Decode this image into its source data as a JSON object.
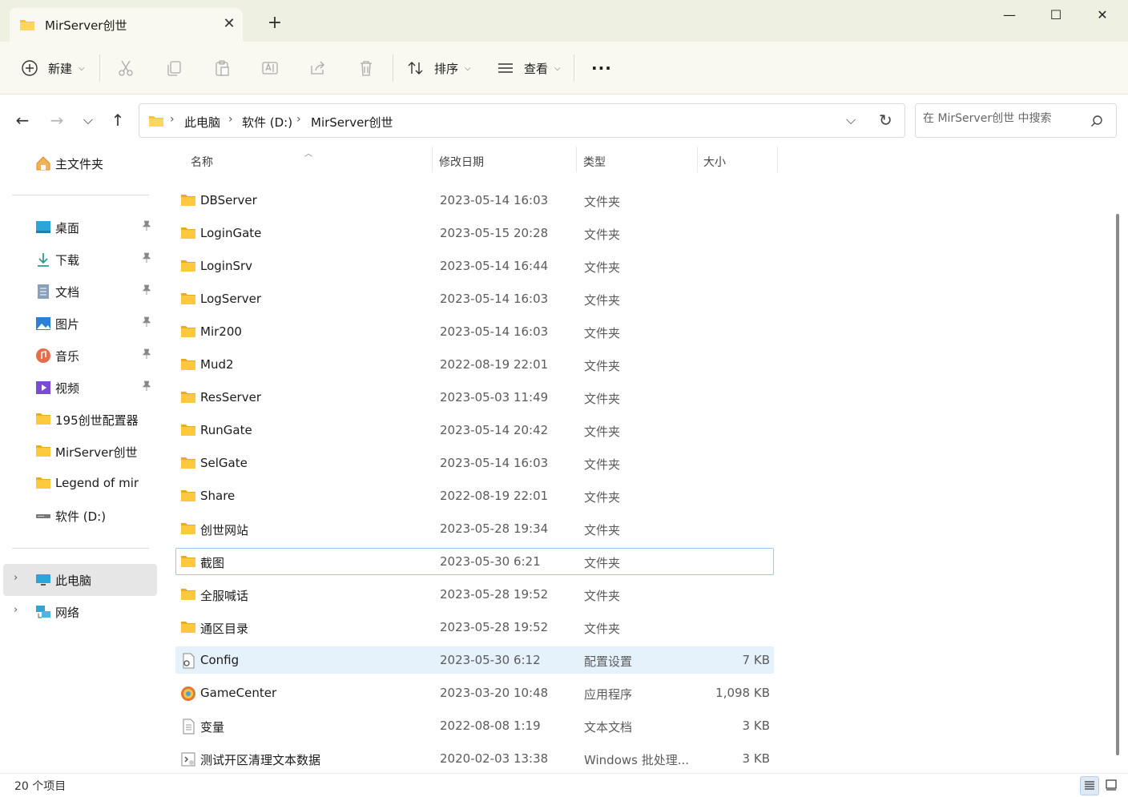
{
  "window": {
    "tab_title": "MirServer创世",
    "new_tab_icon": "plus-icon",
    "controls": {
      "minimize": "minimize-icon",
      "maximize": "maximize-icon",
      "close": "close-icon"
    }
  },
  "toolbar": {
    "new_label": "新建",
    "sort_label": "排序",
    "view_label": "查看",
    "more_label": "···",
    "icons": [
      "cut-icon",
      "copy-icon",
      "paste-icon",
      "rename-icon",
      "share-icon",
      "delete-icon"
    ]
  },
  "address": {
    "crumbs": [
      "此电脑",
      "软件 (D:)",
      "MirServer创世"
    ],
    "search_placeholder": "在 MirServer创世 中搜索"
  },
  "sidebar": {
    "home": "主文件夹",
    "quick": [
      {
        "label": "桌面",
        "icon": "desktop-icon",
        "pinned": true
      },
      {
        "label": "下载",
        "icon": "download-icon",
        "pinned": true
      },
      {
        "label": "文档",
        "icon": "document-icon",
        "pinned": true
      },
      {
        "label": "图片",
        "icon": "pictures-icon",
        "pinned": true
      },
      {
        "label": "音乐",
        "icon": "music-icon",
        "pinned": true
      },
      {
        "label": "视频",
        "icon": "video-icon",
        "pinned": true
      },
      {
        "label": "195创世配置器",
        "icon": "folder-icon",
        "pinned": false
      },
      {
        "label": "MirServer创世",
        "icon": "folder-icon",
        "pinned": false
      },
      {
        "label": "Legend of mir",
        "icon": "folder-icon",
        "pinned": false
      },
      {
        "label": "软件 (D:)",
        "icon": "drive-icon",
        "pinned": false
      }
    ],
    "this_pc": "此电脑",
    "network": "网络"
  },
  "columns": {
    "name": "名称",
    "date": "修改日期",
    "type": "类型",
    "size": "大小"
  },
  "files": [
    {
      "name": "DBServer",
      "date": "2023-05-14 16:03",
      "type": "文件夹",
      "size": "",
      "icon": "folder"
    },
    {
      "name": "LoginGate",
      "date": "2023-05-15 20:28",
      "type": "文件夹",
      "size": "",
      "icon": "folder"
    },
    {
      "name": "LoginSrv",
      "date": "2023-05-14 16:44",
      "type": "文件夹",
      "size": "",
      "icon": "folder"
    },
    {
      "name": "LogServer",
      "date": "2023-05-14 16:03",
      "type": "文件夹",
      "size": "",
      "icon": "folder"
    },
    {
      "name": "Mir200",
      "date": "2023-05-14 16:03",
      "type": "文件夹",
      "size": "",
      "icon": "folder"
    },
    {
      "name": "Mud2",
      "date": "2022-08-19 22:01",
      "type": "文件夹",
      "size": "",
      "icon": "folder"
    },
    {
      "name": "ResServer",
      "date": "2023-05-03 11:49",
      "type": "文件夹",
      "size": "",
      "icon": "folder"
    },
    {
      "name": "RunGate",
      "date": "2023-05-14 20:42",
      "type": "文件夹",
      "size": "",
      "icon": "folder"
    },
    {
      "name": "SelGate",
      "date": "2023-05-14 16:03",
      "type": "文件夹",
      "size": "",
      "icon": "folder"
    },
    {
      "name": "Share",
      "date": "2022-08-19 22:01",
      "type": "文件夹",
      "size": "",
      "icon": "folder"
    },
    {
      "name": "创世网站",
      "date": "2023-05-28 19:34",
      "type": "文件夹",
      "size": "",
      "icon": "folder"
    },
    {
      "name": "截图",
      "date": "2023-05-30 6:21",
      "type": "文件夹",
      "size": "",
      "icon": "folder"
    },
    {
      "name": "全服喊话",
      "date": "2023-05-28 19:52",
      "type": "文件夹",
      "size": "",
      "icon": "folder"
    },
    {
      "name": "通区目录",
      "date": "2023-05-28 19:52",
      "type": "文件夹",
      "size": "",
      "icon": "folder"
    },
    {
      "name": "Config",
      "date": "2023-05-30 6:12",
      "type": "配置设置",
      "size": "7 KB",
      "icon": "config"
    },
    {
      "name": "GameCenter",
      "date": "2023-03-20 10:48",
      "type": "应用程序",
      "size": "1,098 KB",
      "icon": "app"
    },
    {
      "name": "变量",
      "date": "2022-08-08 1:19",
      "type": "文本文档",
      "size": "3 KB",
      "icon": "text"
    },
    {
      "name": "测试开区清理文本数据",
      "date": "2020-02-03 13:38",
      "type": "Windows 批处理...",
      "size": "3 KB",
      "icon": "batch"
    }
  ],
  "focused_row": 11,
  "selected_row": 14,
  "status": {
    "count": "20 个项目"
  },
  "colors": {
    "title_bg": "#eef0e1",
    "toolbar_bg": "#f9f9f2",
    "folder": "#f6c343",
    "selection": "#e5f1fb",
    "focus_border": "#99c9ef"
  }
}
